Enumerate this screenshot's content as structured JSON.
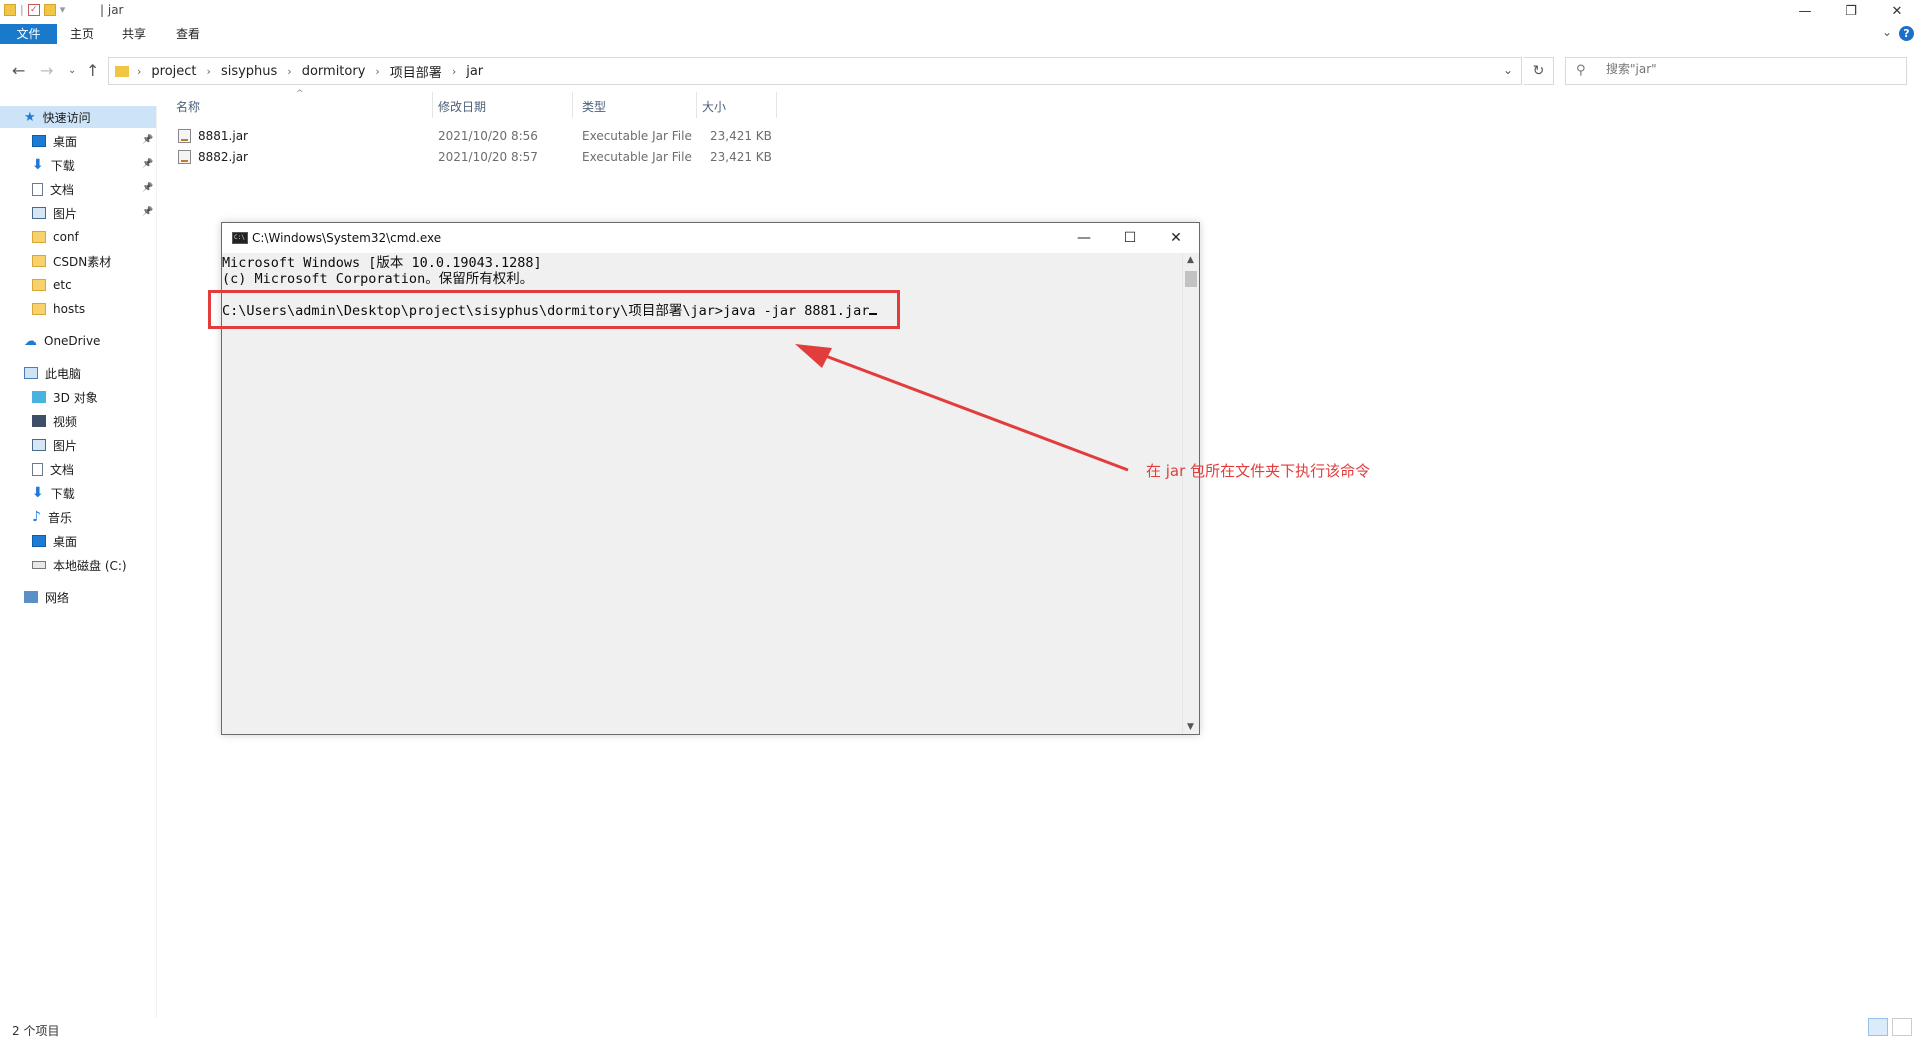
{
  "window": {
    "title": "| jar",
    "minimize": "—",
    "maximize": "❐",
    "close": "✕"
  },
  "ribbon": {
    "tabs": [
      "文件",
      "主页",
      "共享",
      "查看"
    ],
    "help": "?"
  },
  "address": {
    "crumbs": [
      "project",
      "sisyphus",
      "dormitory",
      "项目部署",
      "jar"
    ],
    "search_placeholder": "搜索\"jar\""
  },
  "sidebar": {
    "items": [
      {
        "label": "快速访问",
        "icon": "star-icon"
      },
      {
        "label": "桌面",
        "icon": "desktop-icon",
        "pinned": true
      },
      {
        "label": "下载",
        "icon": "download-icon",
        "pinned": true
      },
      {
        "label": "文档",
        "icon": "document-icon",
        "pinned": true
      },
      {
        "label": "图片",
        "icon": "picture-icon",
        "pinned": true
      },
      {
        "label": "conf",
        "icon": "folder-icon"
      },
      {
        "label": "CSDN素材",
        "icon": "folder-icon"
      },
      {
        "label": "etc",
        "icon": "folder-icon"
      },
      {
        "label": "hosts",
        "icon": "folder-icon"
      },
      {
        "label": "OneDrive",
        "icon": "cloud-icon"
      },
      {
        "label": "此电脑",
        "icon": "computer-icon"
      },
      {
        "label": "3D 对象",
        "icon": "cube-icon"
      },
      {
        "label": "视频",
        "icon": "video-icon"
      },
      {
        "label": "图片",
        "icon": "picture-icon"
      },
      {
        "label": "文档",
        "icon": "document-icon"
      },
      {
        "label": "下载",
        "icon": "download-icon"
      },
      {
        "label": "音乐",
        "icon": "music-icon"
      },
      {
        "label": "桌面",
        "icon": "desktop-icon"
      },
      {
        "label": "本地磁盘 (C:)",
        "icon": "drive-icon"
      },
      {
        "label": "网络",
        "icon": "network-icon"
      }
    ]
  },
  "filelist": {
    "columns": [
      "名称",
      "修改日期",
      "类型",
      "大小"
    ],
    "rows": [
      {
        "name": "8881.jar",
        "date": "2021/10/20 8:56",
        "type": "Executable Jar File",
        "size": "23,421 KB"
      },
      {
        "name": "8882.jar",
        "date": "2021/10/20 8:57",
        "type": "Executable Jar File",
        "size": "23,421 KB"
      }
    ]
  },
  "cmd": {
    "title": "C:\\Windows\\System32\\cmd.exe",
    "lines": [
      "Microsoft Windows [版本 10.0.19043.1288]",
      "(c) Microsoft Corporation。保留所有权利。",
      "",
      "C:\\Users\\admin\\Desktop\\project\\sisyphus\\dormitory\\项目部署\\jar>java -jar 8881.jar"
    ]
  },
  "annotation": {
    "text": "在 jar 包所在文件夹下执行该命令",
    "color": "#e23d3d"
  },
  "status": {
    "count": "2 个项目"
  }
}
